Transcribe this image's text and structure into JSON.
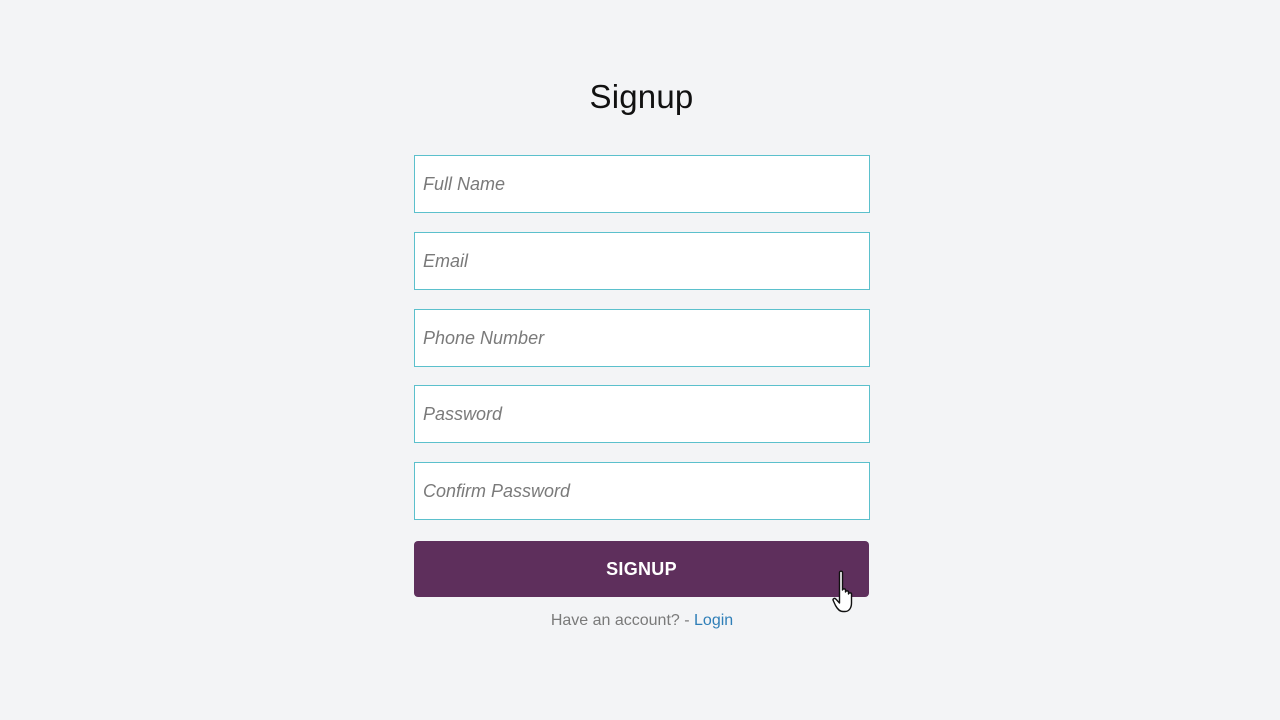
{
  "page": {
    "title": "Signup"
  },
  "form": {
    "fields": [
      {
        "name": "full-name",
        "placeholder": "Full Name",
        "value": ""
      },
      {
        "name": "email",
        "placeholder": "Email",
        "value": ""
      },
      {
        "name": "phone-number",
        "placeholder": "Phone Number",
        "value": ""
      },
      {
        "name": "password",
        "placeholder": "Password",
        "value": ""
      },
      {
        "name": "confirm-password",
        "placeholder": "Confirm Password",
        "value": ""
      }
    ],
    "submit_label": "SIGNUP"
  },
  "footer": {
    "prompt": "Have an account? - ",
    "login_label": "Login"
  },
  "colors": {
    "background": "#f3f4f6",
    "field_border": "#5bc0cc",
    "button": "#5e2f5c",
    "link": "#2f7fb8"
  },
  "icons": {
    "cursor": "hand-pointer-icon"
  }
}
